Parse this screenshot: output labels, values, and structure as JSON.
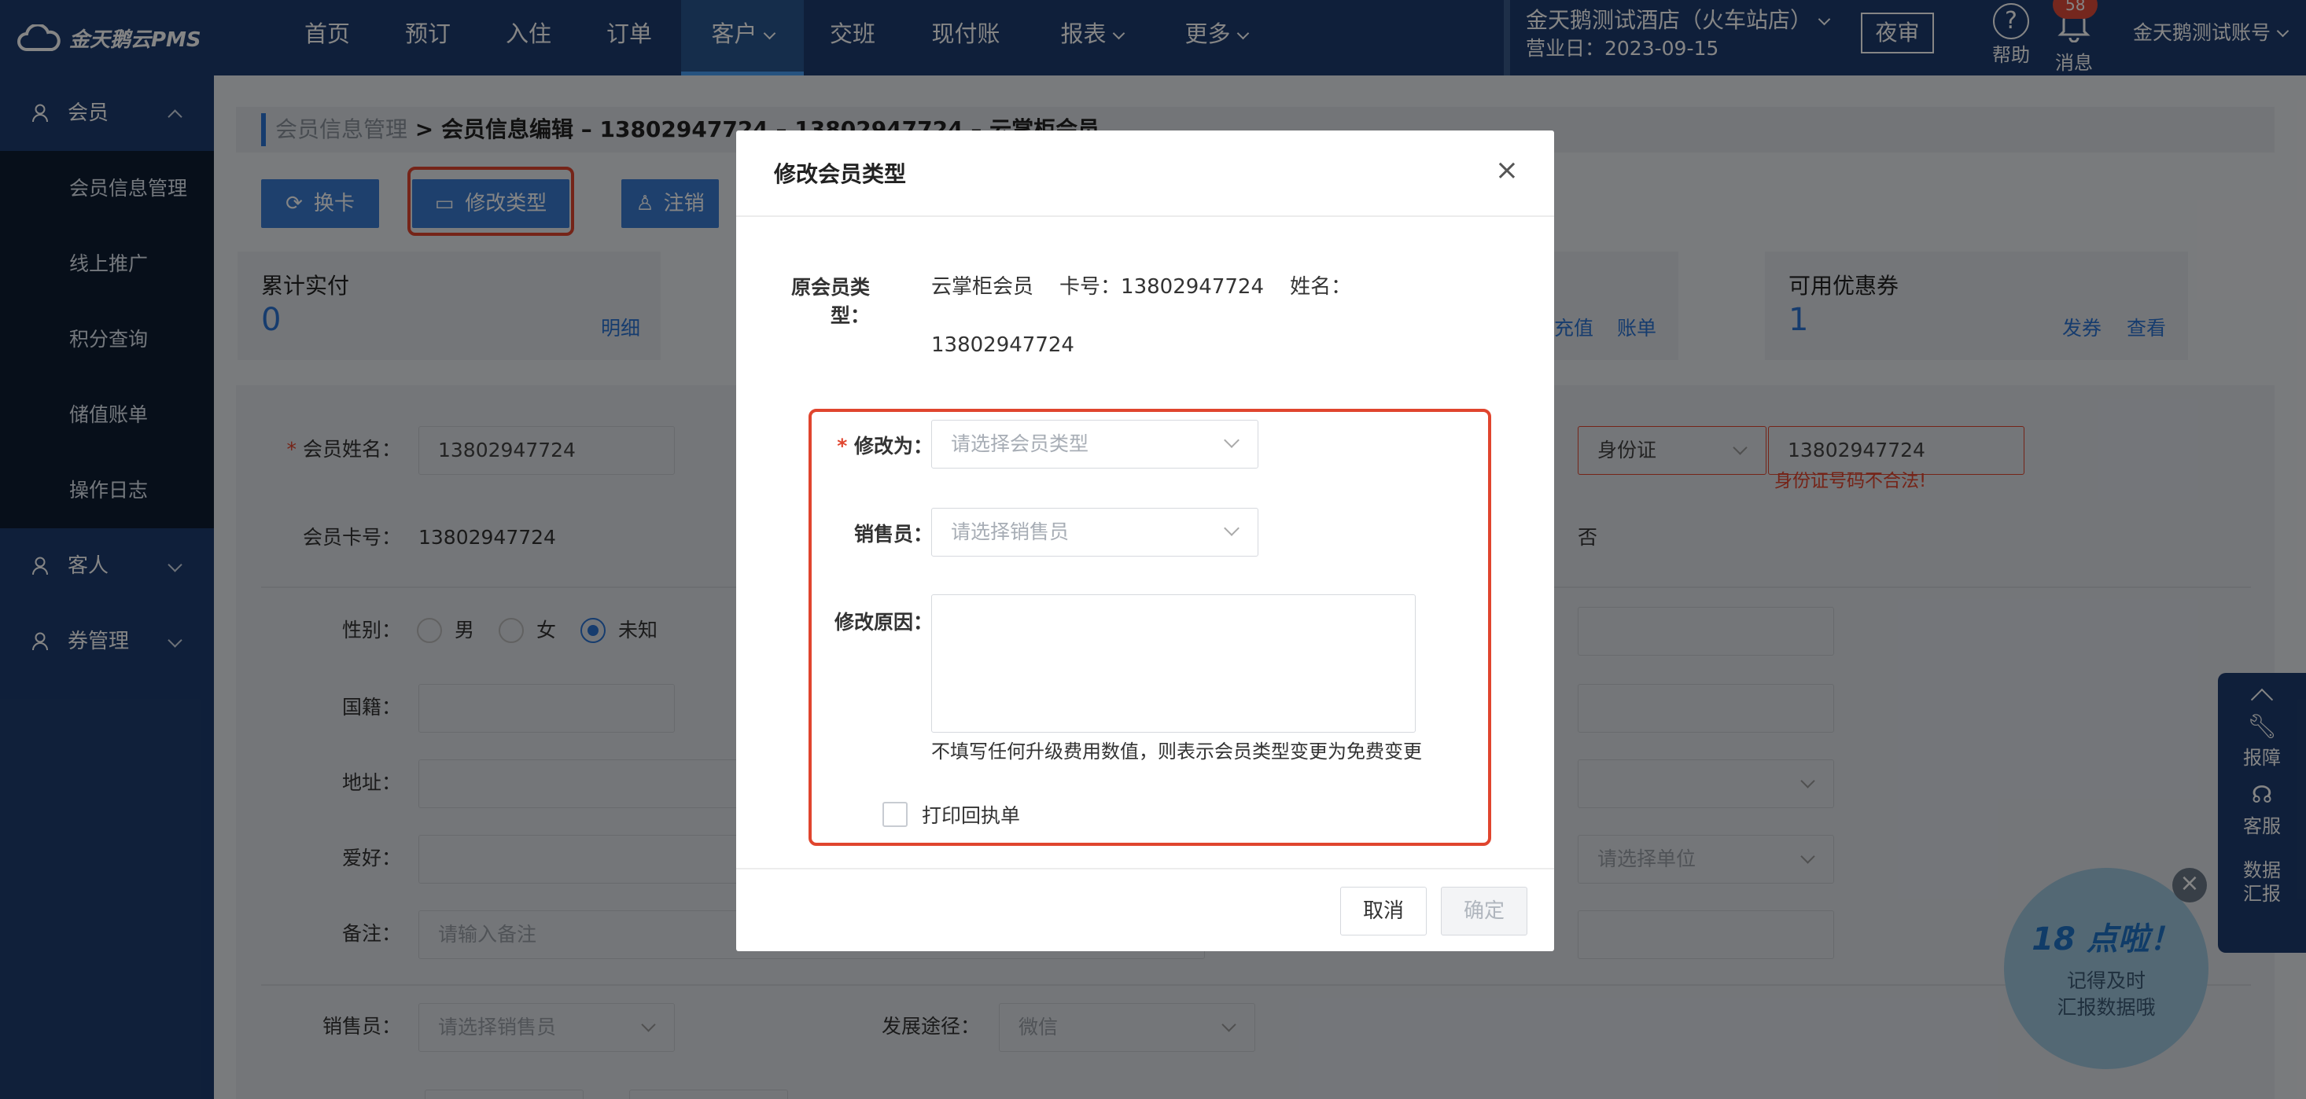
{
  "app": {
    "logo": "金天鹅云PMS"
  },
  "nav": {
    "items": [
      {
        "label": "首页"
      },
      {
        "label": "预订"
      },
      {
        "label": "入住"
      },
      {
        "label": "订单"
      },
      {
        "label": "客户"
      },
      {
        "label": "交班"
      },
      {
        "label": "现付账"
      },
      {
        "label": "报表"
      },
      {
        "label": "更多"
      }
    ]
  },
  "topbar": {
    "hotel": "金天鹅测试酒店（火车站店）",
    "biz_date": "营业日：2023-09-15",
    "night_audit": "夜审",
    "help": "帮助",
    "messages": "消息",
    "msg_count": "58",
    "account": "金天鹅测试账号"
  },
  "sidebar": {
    "member": "会员",
    "member_items": [
      "会员信息管理",
      "线上推广",
      "积分查询",
      "储值账单",
      "操作日志"
    ],
    "guest": "客人",
    "coupon": "券管理"
  },
  "breadcrumb": {
    "parent": "会员信息管理",
    "sep": " > ",
    "current": "会员信息编辑 – 13802947724 – 13802947724 – 云掌柜会员"
  },
  "actions": {
    "swap": "换卡",
    "change_type": "修改类型",
    "cancel": "注销"
  },
  "cards": {
    "paid": {
      "title": "累计实付",
      "value": "0",
      "link": "明细"
    },
    "stored": {
      "recharge": "充值",
      "bill": "账单"
    },
    "coupon": {
      "title": "可用优惠券",
      "value": "1",
      "issue": "发券",
      "view": "查看"
    }
  },
  "form": {
    "name_label": "会员姓名：",
    "name_value": "13802947724",
    "card_label": "会员卡号：",
    "card_value": "13802947724",
    "gender_label": "性别：",
    "gender_options": [
      "男",
      "女",
      "未知"
    ],
    "nationality_label": "国籍：",
    "address_label": "地址：",
    "hobby_label": "爱好：",
    "note_label": "备注：",
    "note_placeholder": "请输入备注",
    "sales_label": "销售员：",
    "sales_placeholder": "请选择销售员",
    "channel_label": "发展途径：",
    "channel_value": "微信",
    "id_type": "身份证",
    "id_value": "13802947724",
    "id_error": "身份证号码不合法!",
    "right_value_no": "否",
    "unit_placeholder": "请选择单位"
  },
  "dialog": {
    "title": "修改会员类型",
    "orig_label": "原会员类型：",
    "orig_line1": "云掌柜会员    卡号：13802947724    姓名：",
    "orig_line2": "13802947724",
    "change_to_label": "修改为：",
    "change_to_placeholder": "请选择会员类型",
    "sales_label": "销售员：",
    "sales_placeholder": "请选择销售员",
    "reason_label": "修改原因：",
    "hint": "不填写任何升级费用数值，则表示会员类型变更为免费变更",
    "print_receipt": "打印回执单",
    "cancel": "取消",
    "confirm": "确定"
  },
  "side_panel": {
    "report": "报障",
    "service": "客服",
    "data_report": "数据汇报"
  },
  "promo": {
    "title": "18 点啦！",
    "line1": "记得及时",
    "line2": "汇报数据哦"
  }
}
